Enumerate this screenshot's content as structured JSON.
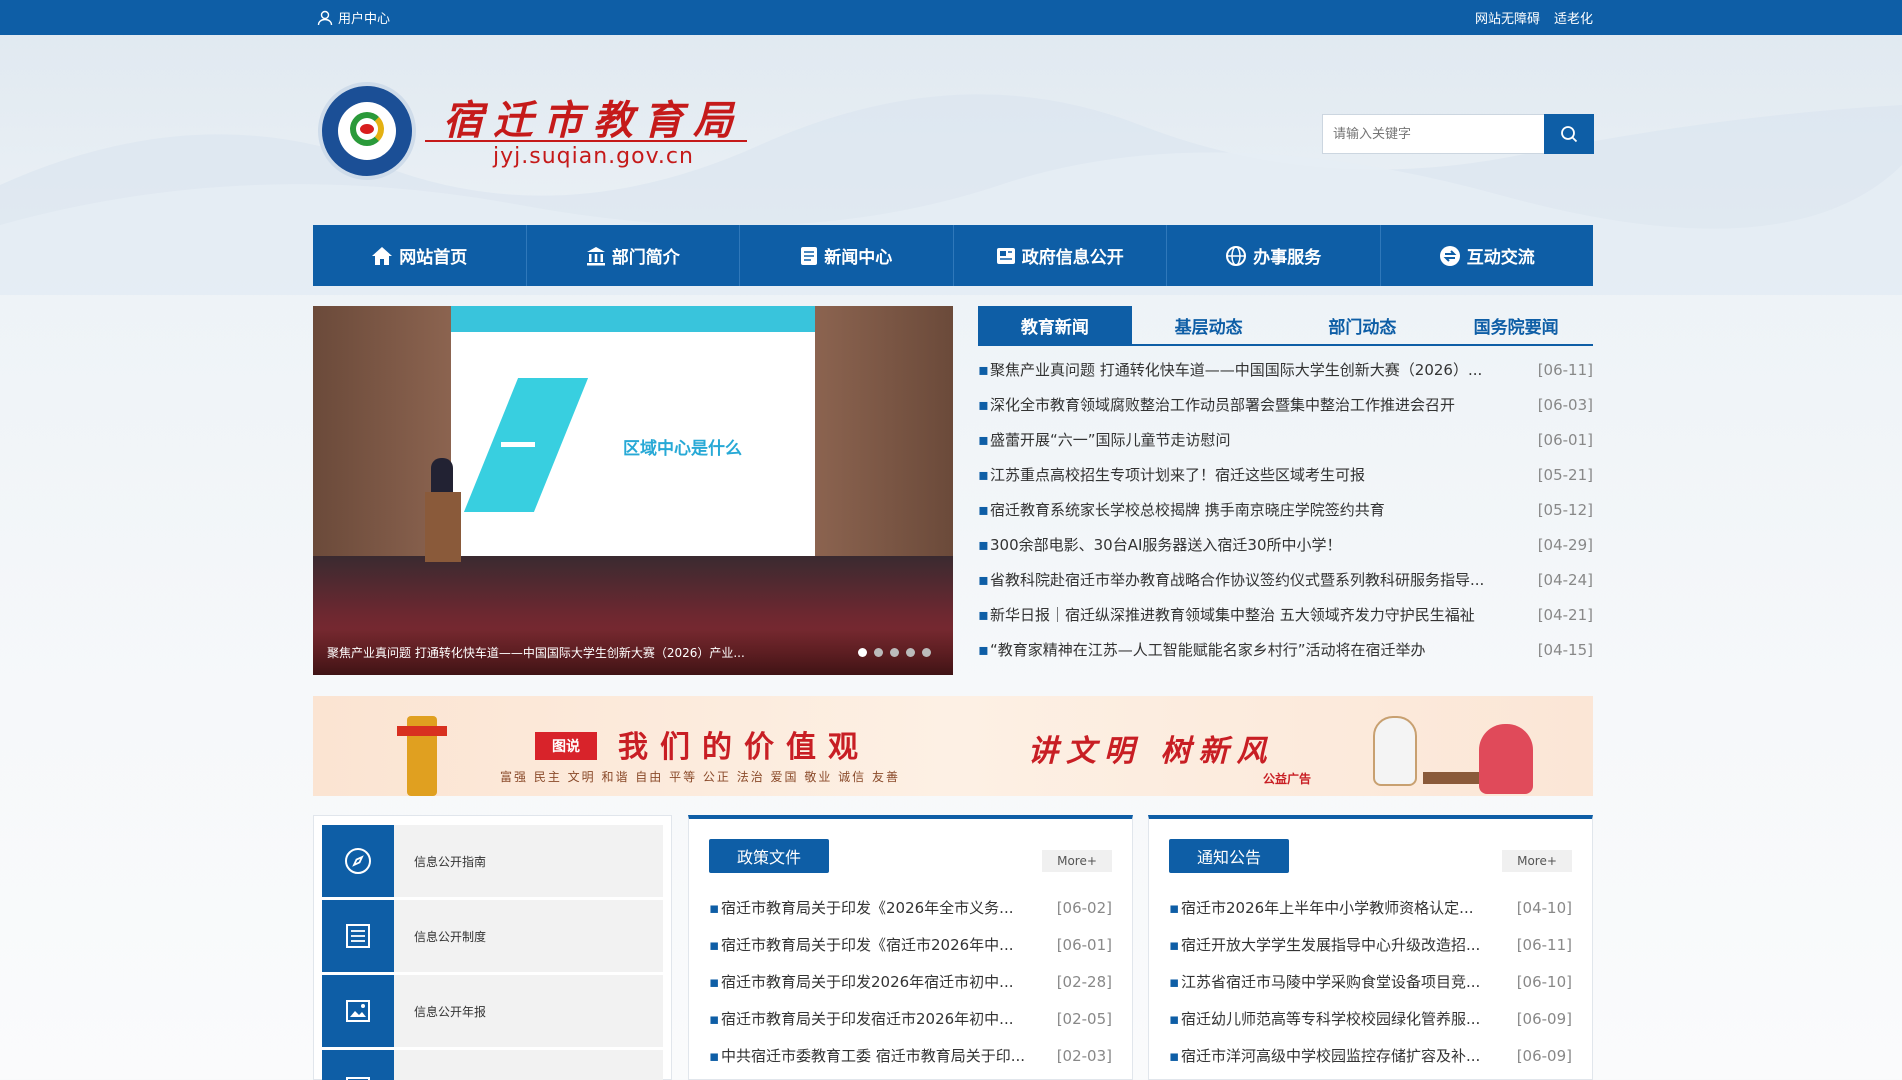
{
  "topbar": {
    "user_center": "用户中心",
    "accessibility": "网站无障碍",
    "elderly": "适老化"
  },
  "header": {
    "site_title": "宿迁市教育局",
    "domain": "jyj.suqian.gov.cn",
    "search_placeholder": "请输入关键字"
  },
  "nav": {
    "items": [
      {
        "label": "网站首页",
        "icon": "home-icon"
      },
      {
        "label": "部门简介",
        "icon": "building-icon"
      },
      {
        "label": "新闻中心",
        "icon": "document-icon"
      },
      {
        "label": "政府信息公开",
        "icon": "newspaper-icon"
      },
      {
        "label": "办事服务",
        "icon": "globe-icon"
      },
      {
        "label": "互动交流",
        "icon": "exchange-icon"
      }
    ]
  },
  "carousel": {
    "slide_text": "区域中心是什么",
    "caption": "聚焦产业真问题 打通转化快车道——中国国际大学生创新大赛（2026）产业...",
    "slide_count": 5,
    "active_slide": 1
  },
  "news": {
    "tabs": [
      "教育新闻",
      "基层动态",
      "部门动态",
      "国务院要闻"
    ],
    "active_tab": 0,
    "items": [
      {
        "title": "聚焦产业真问题 打通转化快车道——中国国际大学生创新大赛（2026）...",
        "date": "[06-11]"
      },
      {
        "title": "深化全市教育领域腐败整治工作动员部署会暨集中整治工作推进会召开",
        "date": "[06-03]"
      },
      {
        "title": "盛蕾开展“六一”国际儿童节走访慰问",
        "date": "[06-01]"
      },
      {
        "title": "江苏重点高校招生专项计划来了！宿迁这些区域考生可报",
        "date": "[05-21]"
      },
      {
        "title": "宿迁教育系统家长学校总校揭牌 携手南京晓庄学院签约共育",
        "date": "[05-12]"
      },
      {
        "title": "300余部电影、30台AI服务器送入宿迁30所中小学！",
        "date": "[04-29]"
      },
      {
        "title": "省教科院赴宿迁市举办教育战略合作协议签约仪式暨系列教科研服务指导...",
        "date": "[04-24]"
      },
      {
        "title": "新华日报｜宿迁纵深推进教育领域集中整治 五大领域齐发力守护民生福祉",
        "date": "[04-21]"
      },
      {
        "title": "“教育家精神在江苏—人工智能赋能名家乡村行”活动将在宿迁举办",
        "date": "[04-15]"
      }
    ]
  },
  "banner": {
    "tag": "图说",
    "headline": "我们的价值观",
    "values": "富强 民主 文明 和谐 自由 平等 公正 法治 爱国 敬业 诚信 友善",
    "slogan": "讲文明 树新风",
    "ad_label": "公益广告"
  },
  "info_public": {
    "items": [
      {
        "label": "信息公开指南",
        "icon": "compass-icon"
      },
      {
        "label": "信息公开制度",
        "icon": "list-icon"
      },
      {
        "label": "信息公开年报",
        "icon": "picture-icon"
      },
      {
        "label": "",
        "icon": "folder-icon"
      }
    ]
  },
  "policy": {
    "title": "政策文件",
    "more": "More+",
    "items": [
      {
        "title": "宿迁市教育局关于印发《2026年全市义务...",
        "date": "[06-02]"
      },
      {
        "title": "宿迁市教育局关于印发《宿迁市2026年中...",
        "date": "[06-01]"
      },
      {
        "title": "宿迁市教育局关于印发2026年宿迁市初中...",
        "date": "[02-28]"
      },
      {
        "title": "宿迁市教育局关于印发宿迁市2026年初中...",
        "date": "[02-05]"
      },
      {
        "title": "中共宿迁市委教育工委 宿迁市教育局关于印...",
        "date": "[02-03]"
      }
    ]
  },
  "notice": {
    "title": "通知公告",
    "more": "More+",
    "items": [
      {
        "title": "宿迁市2026年上半年中小学教师资格认定...",
        "date": "[04-10]"
      },
      {
        "title": "宿迁开放大学学生发展指导中心升级改造招...",
        "date": "[06-11]"
      },
      {
        "title": "江苏省宿迁市马陵中学采购食堂设备项目竞...",
        "date": "[06-10]"
      },
      {
        "title": "宿迁幼儿师范高等专科学校校园绿化管养服...",
        "date": "[06-09]"
      },
      {
        "title": "宿迁市洋河高级中学校园监控存储扩容及补...",
        "date": "[06-09]"
      }
    ]
  },
  "colors": {
    "primary": "#0e5ea6",
    "brand_red": "#c51a1a"
  }
}
